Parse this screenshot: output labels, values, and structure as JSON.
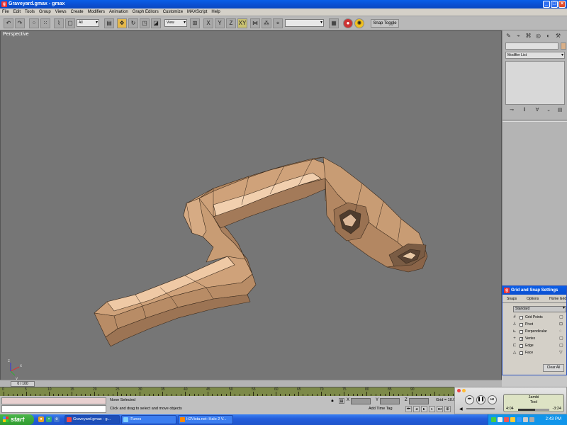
{
  "window": {
    "title": "Graveyard.gmax - gmax",
    "app_icon": "gmax-icon",
    "controls": [
      "minimize",
      "maximize",
      "close"
    ]
  },
  "menu": [
    "File",
    "Edit",
    "Tools",
    "Group",
    "Views",
    "Create",
    "Modifiers",
    "Animation",
    "Graph Editors",
    "Customize",
    "MAXScript",
    "Help"
  ],
  "toolbar": {
    "selection_filter": "All",
    "reference_coord": "View",
    "named_selection": "",
    "snap_toggle": "Snap Toggle"
  },
  "viewport": {
    "label": "Perspective",
    "axis_labels": [
      "x",
      "y",
      "z"
    ],
    "model_color": "#d9b08a",
    "background": "#767676"
  },
  "command_panel": {
    "modifier_list": "Modifier List",
    "object_color": "#d9b089"
  },
  "grid_snap": {
    "title": "Grid and Snap Settings",
    "tabs": [
      "Snaps",
      "Options",
      "Home Grid"
    ],
    "preset": "Standard",
    "items": [
      {
        "label": "Grid Points",
        "checked": false,
        "icon": "grid-points-icon"
      },
      {
        "label": "Pivot",
        "checked": false,
        "icon": "pivot-icon"
      },
      {
        "label": "Perpendicular",
        "checked": false,
        "icon": "perpendicular-icon"
      },
      {
        "label": "Vertex",
        "checked": true,
        "icon": "vertex-icon"
      },
      {
        "label": "Edge",
        "checked": false,
        "icon": "edge-icon"
      },
      {
        "label": "Face",
        "checked": false,
        "icon": "face-icon"
      }
    ],
    "clear_all": "Clear All"
  },
  "timeline": {
    "frame": "0 / 100",
    "ticks": [
      "0",
      "5",
      "10",
      "15",
      "20",
      "25",
      "30",
      "35",
      "40",
      "45",
      "50",
      "55",
      "60",
      "65",
      "70",
      "75",
      "80",
      "85",
      "90"
    ]
  },
  "status": {
    "selection": "None Selected",
    "prompt": "Click and drag to select and move objects",
    "coord_labels": [
      "X",
      "Y",
      "Z"
    ],
    "grid": "Grid = 10.0",
    "add_time_tag": "Add Time Tag"
  },
  "itunes": {
    "song_title": "Jambi",
    "artist": "Tool",
    "time_elapsed": "4:04",
    "time_remaining": "-3:24",
    "progress": 0.54
  },
  "taskbar": {
    "start": "start",
    "tasks": [
      {
        "label": "Graveyard.gmax - g...",
        "active": true,
        "color": "#e44"
      },
      {
        "label": "iTunes",
        "active": false,
        "color": "#7fd0ff"
      },
      {
        "label": "H2Vista.net: Halo 2 V...",
        "active": false,
        "color": "#f80"
      }
    ],
    "clock": "2:43 PM"
  }
}
